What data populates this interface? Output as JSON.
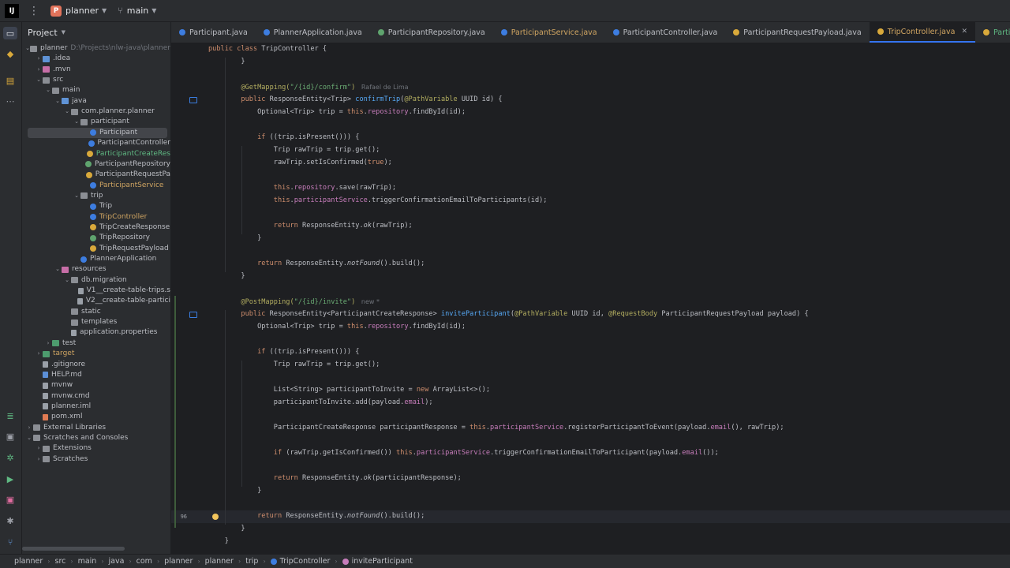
{
  "titlebar": {
    "project_badge": "P",
    "project": "planner",
    "branch": "main"
  },
  "project_panel": {
    "header": "Project",
    "items": [
      {
        "label": "planner",
        "path": "D:\\Projects\\nlw-java\\planner",
        "depth": 0,
        "open": true,
        "icon": "folder"
      },
      {
        "label": ".idea",
        "depth": 1,
        "open": false,
        "icon": "folder-blue"
      },
      {
        "label": ".mvn",
        "depth": 1,
        "open": false,
        "icon": "folder-pink"
      },
      {
        "label": "src",
        "depth": 1,
        "open": true,
        "icon": "folder"
      },
      {
        "label": "main",
        "depth": 2,
        "open": true,
        "icon": "folder"
      },
      {
        "label": "java",
        "depth": 3,
        "open": true,
        "icon": "folder-blue"
      },
      {
        "label": "com.planner.planner",
        "depth": 4,
        "open": true,
        "icon": "folder"
      },
      {
        "label": "participant",
        "depth": 5,
        "open": true,
        "icon": "folder"
      },
      {
        "label": "Participant",
        "depth": 6,
        "icon": "cls",
        "selected": true
      },
      {
        "label": "ParticipantController",
        "depth": 6,
        "icon": "cls"
      },
      {
        "label": "ParticipantCreateRes",
        "depth": 6,
        "icon": "rec",
        "color": "green"
      },
      {
        "label": "ParticipantRepository",
        "depth": 6,
        "icon": "iface"
      },
      {
        "label": "ParticipantRequestPa",
        "depth": 6,
        "icon": "rec"
      },
      {
        "label": "ParticipantService",
        "depth": 6,
        "icon": "cls",
        "color": "orange"
      },
      {
        "label": "trip",
        "depth": 5,
        "open": true,
        "icon": "folder"
      },
      {
        "label": "Trip",
        "depth": 6,
        "icon": "cls"
      },
      {
        "label": "TripController",
        "depth": 6,
        "icon": "cls",
        "color": "orange"
      },
      {
        "label": "TripCreateResponse",
        "depth": 6,
        "icon": "rec"
      },
      {
        "label": "TripRepository",
        "depth": 6,
        "icon": "iface"
      },
      {
        "label": "TripRequestPayload",
        "depth": 6,
        "icon": "rec"
      },
      {
        "label": "PlannerApplication",
        "depth": 5,
        "icon": "cls"
      },
      {
        "label": "resources",
        "depth": 3,
        "open": true,
        "icon": "folder-pink"
      },
      {
        "label": "db.migration",
        "depth": 4,
        "open": true,
        "icon": "folder"
      },
      {
        "label": "V1__create-table-trips.s",
        "depth": 5,
        "icon": "file"
      },
      {
        "label": "V2__create-table-partici",
        "depth": 5,
        "icon": "file"
      },
      {
        "label": "static",
        "depth": 4,
        "icon": "folder"
      },
      {
        "label": "templates",
        "depth": 4,
        "icon": "folder"
      },
      {
        "label": "application.properties",
        "depth": 4,
        "icon": "file"
      },
      {
        "label": "test",
        "depth": 2,
        "open": false,
        "icon": "folder-green"
      },
      {
        "label": "target",
        "depth": 1,
        "open": false,
        "icon": "folder-green",
        "color": "orange"
      },
      {
        "label": ".gitignore",
        "depth": 1,
        "icon": "file"
      },
      {
        "label": "HELP.md",
        "depth": 1,
        "icon": "md"
      },
      {
        "label": "mvnw",
        "depth": 1,
        "icon": "file"
      },
      {
        "label": "mvnw.cmd",
        "depth": 1,
        "icon": "file"
      },
      {
        "label": "planner.iml",
        "depth": 1,
        "icon": "file"
      },
      {
        "label": "pom.xml",
        "depth": 1,
        "icon": "xml"
      },
      {
        "label": "External Libraries",
        "depth": 0,
        "open": false,
        "icon": "folder"
      },
      {
        "label": "Scratches and Consoles",
        "depth": 0,
        "open": true,
        "icon": "folder"
      },
      {
        "label": "Extensions",
        "depth": 1,
        "open": false,
        "icon": "folder"
      },
      {
        "label": "Scratches",
        "depth": 1,
        "open": false,
        "icon": "folder"
      }
    ]
  },
  "tabs": [
    {
      "label": "Participant.java",
      "icon": "cls"
    },
    {
      "label": "PlannerApplication.java",
      "icon": "cls"
    },
    {
      "label": "ParticipantRepository.java",
      "icon": "iface"
    },
    {
      "label": "ParticipantService.java",
      "icon": "cls",
      "color": "orange"
    },
    {
      "label": "ParticipantController.java",
      "icon": "cls"
    },
    {
      "label": "ParticipantRequestPayload.java",
      "icon": "rec"
    },
    {
      "label": "TripController.java",
      "icon": "rec",
      "active": true,
      "color": "orange"
    },
    {
      "label": "ParticipantCreateRe",
      "icon": "rec",
      "color": "green"
    }
  ],
  "editor": {
    "lines": [
      {
        "n": "",
        "t": [
          [
            "public class ",
            "kw"
          ],
          [
            "TripController {",
            ""
          ]
        ]
      },
      {
        "n": "",
        "t": [
          [
            "        }",
            ""
          ]
        ]
      },
      {
        "n": "",
        "t": []
      },
      {
        "n": "",
        "t": [
          [
            "        @GetMapping(",
            "ann"
          ],
          [
            "\"/{id}/confirm\"",
            "str"
          ],
          [
            ")",
            "ann"
          ]
        ],
        "inlay": "Rafael de Lima"
      },
      {
        "n": "",
        "t": [
          [
            "        public ",
            "kw"
          ],
          [
            "ResponseEntity<Trip> ",
            ""
          ],
          [
            "confirmTrip",
            "mth"
          ],
          [
            "(",
            ""
          ],
          [
            "@PathVariable ",
            "ann"
          ],
          [
            "UUID id) {",
            ""
          ]
        ],
        "icon": true
      },
      {
        "n": "",
        "t": [
          [
            "            Optional<Trip> trip = ",
            ""
          ],
          [
            "this",
            "kw"
          ],
          [
            ".",
            ""
          ],
          [
            "repository",
            "fld"
          ],
          [
            ".findById(id);",
            ""
          ]
        ]
      },
      {
        "n": "",
        "t": []
      },
      {
        "n": "",
        "t": [
          [
            "            ",
            ""
          ],
          [
            "if ",
            "kw"
          ],
          [
            "((trip.isPresent())) {",
            ""
          ]
        ]
      },
      {
        "n": "",
        "t": [
          [
            "                Trip rawTrip = trip.get();",
            ""
          ]
        ]
      },
      {
        "n": "",
        "t": [
          [
            "                rawTrip.setIsConfirmed(",
            ""
          ],
          [
            "true",
            "kw"
          ],
          [
            ");",
            ""
          ]
        ]
      },
      {
        "n": "",
        "t": []
      },
      {
        "n": "",
        "t": [
          [
            "                ",
            ""
          ],
          [
            "this",
            "kw"
          ],
          [
            ".",
            ""
          ],
          [
            "repository",
            "fld"
          ],
          [
            ".save(rawTrip);",
            ""
          ]
        ]
      },
      {
        "n": "",
        "t": [
          [
            "                ",
            ""
          ],
          [
            "this",
            "kw"
          ],
          [
            ".",
            ""
          ],
          [
            "participantService",
            "fld"
          ],
          [
            ".triggerConfirmationEmailToParticipants(id);",
            ""
          ]
        ]
      },
      {
        "n": "",
        "t": []
      },
      {
        "n": "",
        "t": [
          [
            "                ",
            ""
          ],
          [
            "return ",
            "kw"
          ],
          [
            "ResponseEntity.",
            ""
          ],
          [
            "ok",
            "st"
          ],
          [
            "(rawTrip);",
            ""
          ]
        ]
      },
      {
        "n": "",
        "t": [
          [
            "            }",
            ""
          ]
        ]
      },
      {
        "n": "",
        "t": []
      },
      {
        "n": "",
        "t": [
          [
            "            ",
            ""
          ],
          [
            "return ",
            "kw"
          ],
          [
            "ResponseEntity.",
            ""
          ],
          [
            "notFound",
            "st"
          ],
          [
            "().build();",
            ""
          ]
        ]
      },
      {
        "n": "",
        "t": [
          [
            "        }",
            ""
          ]
        ]
      },
      {
        "n": "",
        "t": []
      },
      {
        "n": "",
        "t": [
          [
            "        @PostMapping(",
            "ann"
          ],
          [
            "\"/{id}/invite\"",
            "str"
          ],
          [
            ")",
            "ann"
          ]
        ],
        "inlay": "new *"
      },
      {
        "n": "",
        "t": [
          [
            "        public ",
            "kw"
          ],
          [
            "ResponseEntity<ParticipantCreateResponse> ",
            ""
          ],
          [
            "inviteParticipant",
            "mth"
          ],
          [
            "(",
            ""
          ],
          [
            "@PathVariable ",
            "ann"
          ],
          [
            "UUID id, ",
            ""
          ],
          [
            "@RequestBody ",
            "ann"
          ],
          [
            "ParticipantRequestPayload payload) {",
            ""
          ]
        ],
        "icon": true
      },
      {
        "n": "",
        "t": [
          [
            "            Optional<Trip> trip = ",
            ""
          ],
          [
            "this",
            "kw"
          ],
          [
            ".",
            ""
          ],
          [
            "repository",
            "fld"
          ],
          [
            ".findById(id);",
            ""
          ]
        ]
      },
      {
        "n": "",
        "t": []
      },
      {
        "n": "",
        "t": [
          [
            "            ",
            ""
          ],
          [
            "if ",
            "kw"
          ],
          [
            "((trip.isPresent())) {",
            ""
          ]
        ]
      },
      {
        "n": "",
        "t": [
          [
            "                Trip rawTrip = trip.get();",
            ""
          ]
        ]
      },
      {
        "n": "",
        "t": []
      },
      {
        "n": "",
        "t": [
          [
            "                List<String> participantToInvite = ",
            ""
          ],
          [
            "new ",
            "kw"
          ],
          [
            "ArrayList<>();",
            ""
          ]
        ]
      },
      {
        "n": "",
        "t": [
          [
            "                participantToInvite.add(payload.",
            ""
          ],
          [
            "email",
            "fld"
          ],
          [
            ");",
            ""
          ]
        ]
      },
      {
        "n": "",
        "t": []
      },
      {
        "n": "",
        "t": [
          [
            "                ParticipantCreateResponse participantResponse = ",
            ""
          ],
          [
            "this",
            "kw"
          ],
          [
            ".",
            ""
          ],
          [
            "participantService",
            "fld"
          ],
          [
            ".registerParticipantToEvent(payload.",
            ""
          ],
          [
            "email",
            "fld"
          ],
          [
            "(), rawTrip);",
            ""
          ]
        ]
      },
      {
        "n": "",
        "t": []
      },
      {
        "n": "",
        "t": [
          [
            "                ",
            ""
          ],
          [
            "if ",
            "kw"
          ],
          [
            "(rawTrip.getIsConfirmed()) ",
            ""
          ],
          [
            "this",
            "kw"
          ],
          [
            ".",
            ""
          ],
          [
            "participantService",
            "fld"
          ],
          [
            ".triggerConfirmationEmailToParticipant(payload.",
            ""
          ],
          [
            "email",
            "fld"
          ],
          [
            "());",
            ""
          ]
        ]
      },
      {
        "n": "",
        "t": []
      },
      {
        "n": "",
        "t": [
          [
            "                ",
            ""
          ],
          [
            "return ",
            "kw"
          ],
          [
            "ResponseEntity.",
            ""
          ],
          [
            "ok",
            "st"
          ],
          [
            "(participantResponse);",
            ""
          ]
        ]
      },
      {
        "n": "",
        "t": [
          [
            "            }",
            ""
          ]
        ]
      },
      {
        "n": "",
        "t": []
      },
      {
        "n": "96",
        "t": [
          [
            "            ",
            ""
          ],
          [
            "return ",
            "kw"
          ],
          [
            "ResponseEntity.",
            ""
          ],
          [
            "notFound",
            "st"
          ],
          [
            "().build();",
            ""
          ]
        ],
        "caret": true
      },
      {
        "n": "",
        "t": [
          [
            "        }",
            ""
          ]
        ]
      },
      {
        "n": "",
        "t": [
          [
            "    }",
            ""
          ]
        ]
      }
    ]
  },
  "breadcrumbs": [
    "planner",
    "src",
    "main",
    "java",
    "com",
    "planner",
    "planner",
    "trip",
    "TripController",
    "inviteParticipant"
  ],
  "colors": {
    "accent": "#3574f0",
    "bg": "#1e1f22",
    "panel": "#2b2d30"
  }
}
